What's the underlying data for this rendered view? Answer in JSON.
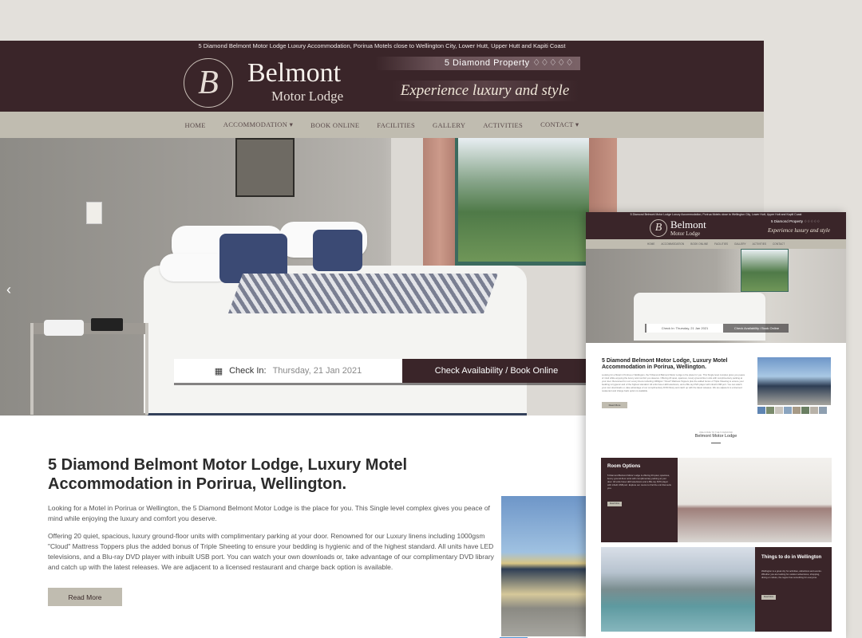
{
  "header": {
    "tagline": "5 Diamond Belmont Motor Lodge Luxury Accommodation, Porirua Motels close to Wellington City, Lower Hutt, Upper Hutt and Kapiti Coast",
    "logo_letter": "B",
    "logo_name": "Belmont",
    "logo_sub": "Motor Lodge",
    "diamond_text": "5 Diamond Property ♢♢♢♢♢",
    "script_text": "Experience luxury and style"
  },
  "nav": {
    "items": [
      "HOME",
      "ACCOMMODATION ▾",
      "BOOK ONLINE",
      "FACILITIES",
      "GALLERY",
      "ACTIVITIES",
      "CONTACT ▾"
    ]
  },
  "hero": {
    "prev_arrow": "‹",
    "checkin_label": "Check In:",
    "checkin_date": "Thursday, 21 Jan 2021",
    "check_button": "Check Availability / Book Online"
  },
  "content": {
    "title": "5 Diamond Belmont Motor Lodge, Luxury Motel Accommodation in Porirua, Wellington.",
    "para1": "Looking for a Motel in Porirua or Wellington, the 5 Diamond Belmont Motor Lodge is the place for you. This Single level complex gives you peace of mind while enjoying the luxury and comfort you deserve.",
    "para2": "Offering 20 quiet, spacious, luxury ground-floor units with complimentary parking at your door. Renowned for our Luxury linens including 1000gsm \"Cloud\" Mattress Toppers plus the added bonus of Triple Sheeting to ensure your bedding is hygienic and of the highest standard. All units have LED televisions, and a Blu-ray DVD player with inbuilt USB port. You can watch your own downloads or, take advantage of our complimentary DVD library and catch up with the latest releases. We are adjacent to a licensed restaurant and charge back option is available.",
    "read_more": "Read More"
  },
  "inset": {
    "tagline": "5 Diamond Belmont Motor Lodge Luxury Accommodation, Porirua Motels close to Wellington City, Lower Hutt, Upper Hutt and Kapiti Coast",
    "logo_letter": "B",
    "logo_name": "Belmont",
    "logo_sub": "Motor Lodge",
    "diamond_text": "5 Diamond Property ♢♢♢♢♢",
    "script_text": "Experience luxury and style",
    "nav": [
      "HOME",
      "ACCOMMODATION",
      "BOOK ONLINE",
      "FACILITIES",
      "GALLERY",
      "ACTIVITIES",
      "CONTACT"
    ],
    "checkin": "Check In:  Thursday, 21 Jan 2021",
    "check_button": "Check Availability / Book Online",
    "title": "5 Diamond Belmont Motor Lodge, Luxury Motel Accommodation in Porirua, Wellington.",
    "para": "Looking for a Motel in Porirua or Wellington, the 5 Diamond Belmont Motor Lodge is the place for you. This Single level complex gives you peace of mind while enjoying the luxury and comfort you deserve. Offering 20 quiet, spacious, luxury ground-floor units with complimentary parking at your door. Renowned for our Luxury linens including 1000gsm \"Cloud\" Mattress Toppers plus the added bonus of Triple Sheeting to ensure your bedding is hygienic and of the highest standard. All units have LED televisions, and a Blu-ray DVD player with inbuilt USB port. You can watch your own downloads or, take advantage of our complimentary DVD library and catch up with the latest releases. We are adjacent to a licensed restaurant and charge back option is available.",
    "read_more": "Read More",
    "section_small": "WELCOME TO THE 5 DIAMOND",
    "section_title": "Belmont Motor Lodge",
    "rooms_title": "Room Options",
    "rooms_text": "5 Diamond Belmont Motor Lodge is offering 20 quiet, spacious, luxury ground-floor units with complimentary parking at your door. All units have LED televisions and a Blu-ray DVD player with inbuilt USB port. Explore our rooms to find the unit that suits you.",
    "rooms_button": "Read More",
    "things_title": "Things to do in Wellington",
    "things_text": "Wellington is a great city for activities, attractions and events. Whether you are looking for outdoor adventures, shopping, dining or culture, the region has something for everyone.",
    "things_button": "Read More"
  },
  "colors": {
    "brand_dark": "#3a2529",
    "nav_bg": "#c0bcb0",
    "background": "#e3e0db"
  }
}
